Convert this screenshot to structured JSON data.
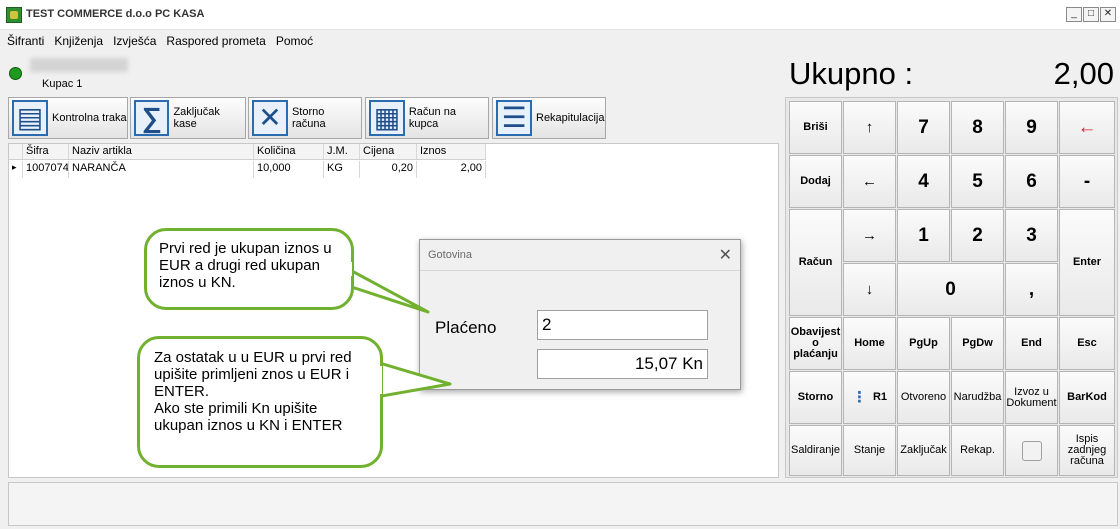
{
  "window": {
    "title": "TEST COMMERCE d.o.o PC KASA",
    "min_glyph": "_",
    "max_glyph": "□",
    "close_glyph": "✕"
  },
  "menu": [
    "Šifranti",
    "Knjiženja",
    "Izvješća",
    "Raspored prometa",
    "Pomoć"
  ],
  "customer": {
    "label": "Kupac 1"
  },
  "total": {
    "label": "Ukupno :",
    "value": "2,00"
  },
  "toolbar": [
    {
      "label": "Kontrolna traka",
      "icon": "document-icon",
      "glyph": "▤"
    },
    {
      "label": "Zaključak kase",
      "icon": "sigma-icon",
      "glyph": "∑"
    },
    {
      "label": "Storno računa",
      "icon": "cross-icon",
      "glyph": "✕"
    },
    {
      "label": "Račun na kupca",
      "icon": "ledger-icon",
      "glyph": "▦"
    },
    {
      "label": "Rekapitulacija",
      "icon": "clipboard-icon",
      "glyph": "☰"
    }
  ],
  "grid": {
    "columns": [
      "Šifra",
      "Naziv artikla",
      "Količina",
      "J.M.",
      "Cijena",
      "Iznos"
    ],
    "rows": [
      {
        "sifra": "1007074",
        "naziv": "NARANČA",
        "kolicina": "10,000",
        "jm": "KG",
        "cijena": "0,20",
        "iznos": "2,00"
      }
    ],
    "row_marker": "▸"
  },
  "keypad": {
    "brisi": "Briši",
    "up": "↑",
    "k7": "7",
    "k8": "8",
    "k9": "9",
    "backspace": "←",
    "dodaj": "Dodaj",
    "left": "←",
    "k4": "4",
    "k5": "5",
    "k6": "6",
    "minus": "-",
    "racun": "Račun",
    "right": "→",
    "k1": "1",
    "k2": "2",
    "k3": "3",
    "enter": "Enter",
    "down": "↓",
    "k0": "0",
    "comma": ",",
    "obavijest": "Obavijest o plaćanju",
    "home": "Home",
    "pgup": "PgUp",
    "pgdw": "PgDw",
    "end": "End",
    "esc": "Esc",
    "storno": "Storno",
    "r1": "R1",
    "otvoreno": "Otvoreno",
    "narudzba": "Narudžba",
    "izvoz": "Izvoz u Dokument",
    "barkod": "BarKod",
    "saldiranje": "Saldiranje",
    "stanje": "Stanje",
    "zakljucak": "Zaključak",
    "rekap": "Rekap.",
    "ispis": "Ispis zadnjeg računa"
  },
  "dialog": {
    "title": "Gotovina",
    "close": "✕",
    "placeno_label": "Plaćeno",
    "placeno_value": "2",
    "kn_value": "15,07 Kn"
  },
  "callouts": {
    "top": "Prvi red je ukupan iznos u EUR a drugi red ukupan iznos u KN.",
    "bottom_line1": "Za ostatak u u EUR u prvi red upišite primljeni znos u EUR i ENTER.",
    "bottom_line2": "Ako ste primili Kn upišite ukupan iznos u KN i ENTER"
  },
  "colors": {
    "callout_border": "#71b12f",
    "status_green": "#1f9a1f",
    "icon_blue": "#2b6cb0",
    "backspace_red": "#c0282d"
  }
}
